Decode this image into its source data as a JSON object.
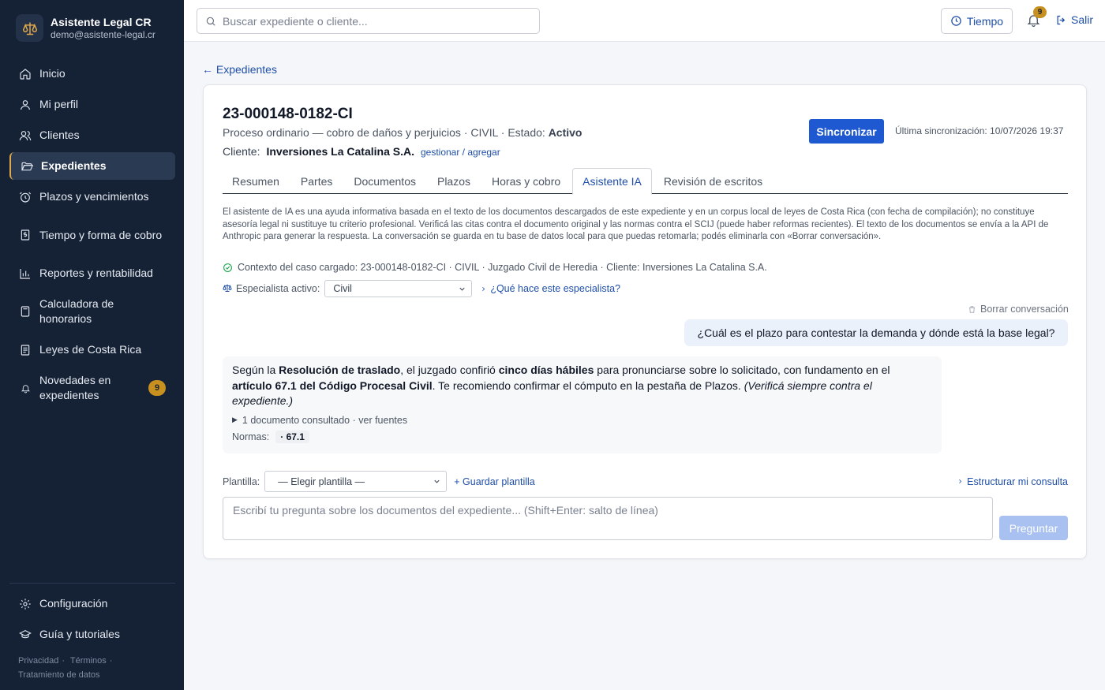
{
  "brand": {
    "name": "Asistente Legal CR",
    "email": "demo@asistente-legal.cr"
  },
  "sidebar": {
    "items": [
      {
        "label": "Inicio"
      },
      {
        "label": "Mi perfil"
      },
      {
        "label": "Clientes"
      },
      {
        "label": "Expedientes"
      },
      {
        "label": "Plazos y vencimientos"
      },
      {
        "label": "Tiempo y forma de cobro"
      },
      {
        "label": "Reportes y rentabilidad"
      },
      {
        "label": "Calculadora de honorarios"
      },
      {
        "label": "Leyes de Costa Rica"
      },
      {
        "label": "Novedades en expedientes",
        "badge": "9"
      }
    ],
    "bottom": [
      {
        "label": "Configuración"
      },
      {
        "label": "Guía y tutoriales"
      }
    ],
    "footer": {
      "privacy": "Privacidad",
      "terms": "Términos",
      "data": "Tratamiento de datos"
    }
  },
  "topbar": {
    "search_placeholder": "Buscar expediente o cliente...",
    "tiempo_label": "Tiempo",
    "bell_badge": "9",
    "logout_label": "Salir"
  },
  "case": {
    "back_label": "← Expedientes",
    "id": "23-000148-0182-CI",
    "subtitle": "Proceso ordinario — cobro de daños y perjuicios · CIVIL · Estado: ",
    "status": "Activo",
    "client_label": "Cliente:",
    "client_name": "Inversiones La Catalina S.A.",
    "client_link": "gestionar / agregar",
    "sync_label": "Sincronizar",
    "last_sync": "Última sincronización: 10/07/2026 19:37"
  },
  "tabs": [
    {
      "label": "Resumen"
    },
    {
      "label": "Partes"
    },
    {
      "label": "Documentos"
    },
    {
      "label": "Plazos"
    },
    {
      "label": "Horas y cobro"
    },
    {
      "label": "Asistente IA",
      "active": true
    },
    {
      "label": "Revisión de escritos"
    }
  ],
  "assistant": {
    "disclaimer": "El asistente de IA es una ayuda informativa basada en el texto de los documentos descargados de este expediente y en un corpus local de leyes de Costa Rica (con fecha de compilación); no constituye asesoría legal ni sustituye tu criterio profesional. Verificá las citas contra el documento original y las normas contra el SCIJ (puede haber reformas recientes). El texto de los documentos se envía a la API de Anthropic para generar la respuesta. La conversación se guarda en tu base de datos local para que puedas retomarla; podés eliminarla con «Borrar conversación».",
    "context": "Contexto del caso cargado: 23-000148-0182-CI · CIVIL · Juzgado Civil de Heredia · Cliente: Inversiones La Catalina S.A.",
    "specialist_label": "Especialista activo:",
    "specialist_value": "Civil",
    "specialist_help": "¿Qué hace este especialista?",
    "clear_label": "Borrar conversación",
    "user_message": "¿Cuál es el plazo para contestar la demanda y dónde está la base legal?",
    "ai_message": {
      "t1": "Según la ",
      "b1": "Resolución de traslado",
      "t2": ", el juzgado confirió ",
      "b2": "cinco días hábiles",
      "t3": " para pronunciarse sobre lo solicitado, con fundamento en el ",
      "b3": "artículo 67.1 del Código Procesal Civil",
      "t4": ". Te recomiendo confirmar el cómputo en la pestaña de Plazos. ",
      "i1": "(Verificá siempre contra el expediente.)",
      "sources": "1 documento consultado · ver fuentes",
      "normas_label": "Normas:",
      "norma": "· 67.1"
    },
    "plantilla_label": "Plantilla:",
    "plantilla_value": "— Elegir plantilla —",
    "save_template": "+ Guardar plantilla",
    "structure": "Estructurar mi consulta",
    "input_placeholder": "Escribí tu pregunta sobre los documentos del expediente... (Shift+Enter: salto de línea)",
    "ask_label": "Preguntar"
  }
}
